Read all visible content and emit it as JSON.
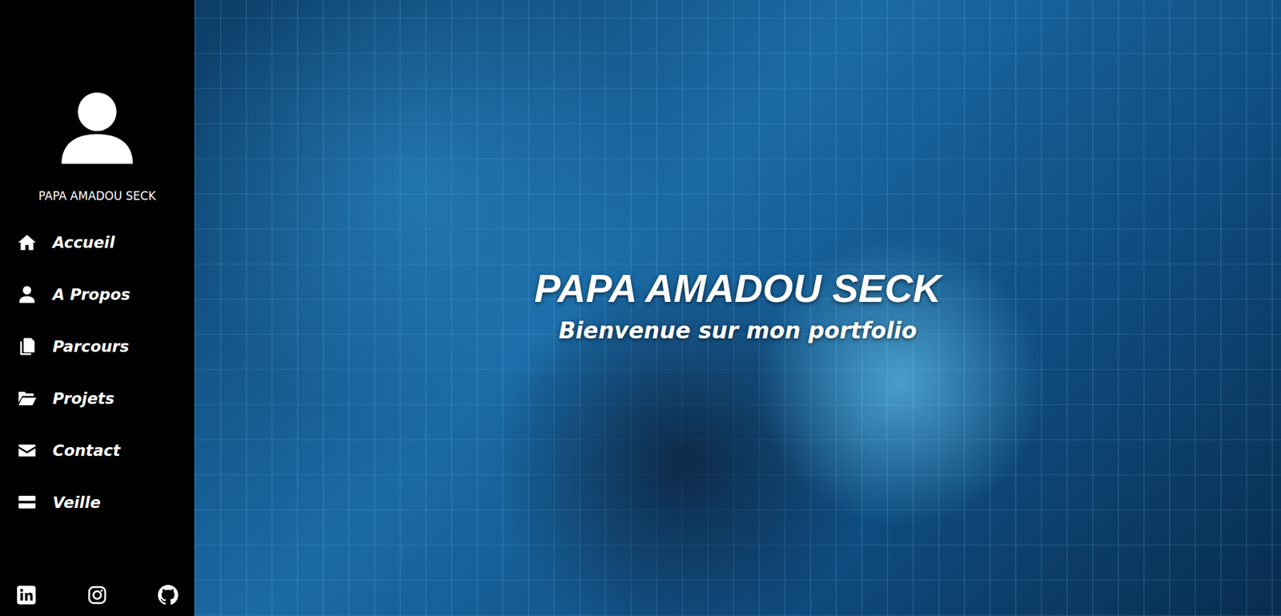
{
  "sidebar": {
    "name": "PAPA AMADOU SECK",
    "items": [
      {
        "label": "Accueil"
      },
      {
        "label": "A Propos"
      },
      {
        "label": "Parcours"
      },
      {
        "label": "Projets"
      },
      {
        "label": "Contact"
      },
      {
        "label": "Veille"
      }
    ],
    "social": [
      {
        "kind": "linkedin"
      },
      {
        "kind": "instagram"
      },
      {
        "kind": "github"
      }
    ]
  },
  "hero": {
    "title": "PAPA AMADOU SECK",
    "subtitle": "Bienvenue sur mon portfolio"
  }
}
